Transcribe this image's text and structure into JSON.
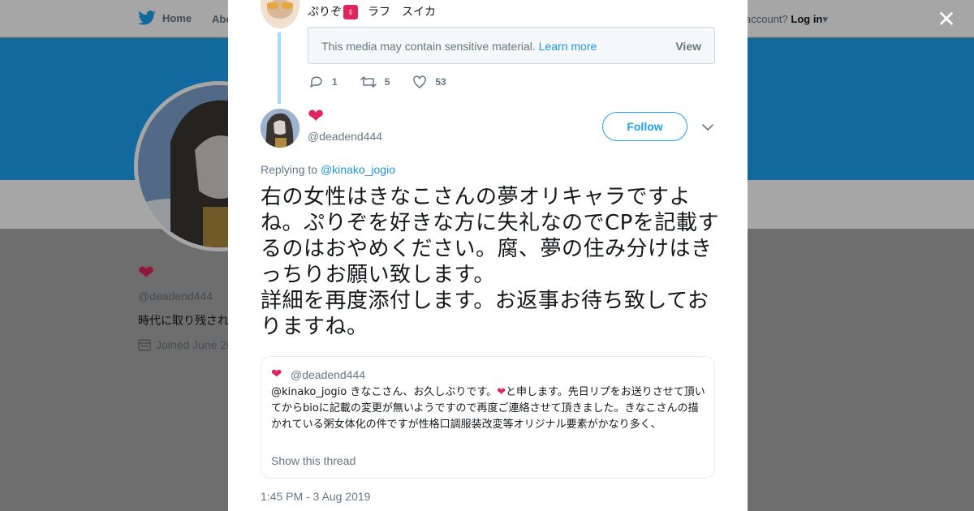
{
  "nav": {
    "home_label": "Home",
    "about_label": "Abo",
    "account_prompt": "account?",
    "login_label": "Log in"
  },
  "profile": {
    "handle": "@deadend444",
    "bio": "時代に取り残され",
    "joined": "Joined June 20"
  },
  "prev_tweet": {
    "name_text": "ぷりぞ",
    "name_extra": "ラフ　スイカ",
    "sensitive_msg": "This media may contain sensitive material.",
    "learn_more": "Learn more",
    "view_label": "View",
    "replies": "1",
    "retweets": "5",
    "likes": "53"
  },
  "tweet": {
    "handle": "@deadend444",
    "follow_label": "Follow",
    "replying_to_label": "Replying to",
    "replying_to_user": "@kinako_jogio",
    "text": "右の女性はきなこさんの夢オリキャラですよね。ぷりぞを好きな方に失礼なのでCPを記載するのはおやめください。腐、夢の住み分けはきっちりお願い致します。\n詳細を再度添付します。お返事お待ち致しております",
    "text_tail": "ね。",
    "timestamp": "1:45 PM - 3 Aug 2019"
  },
  "quote": {
    "handle": "@deadend444",
    "mention": "@kinako_jogio",
    "text_a": "きなこさん、お久しぶりです。",
    "text_b": "と申します。先日リプをお送りさせて頂いてからbioに記載の変更が無いようですので再度ご連絡させて頂きました。きなこさんの描かれている粥女体化の件ですが性格口調服装改変等オリジナル要素がかなり多く、",
    "show_thread": "Show this thread"
  },
  "colors": {
    "accent": "#1da1f2",
    "heart": "#e0245e"
  }
}
